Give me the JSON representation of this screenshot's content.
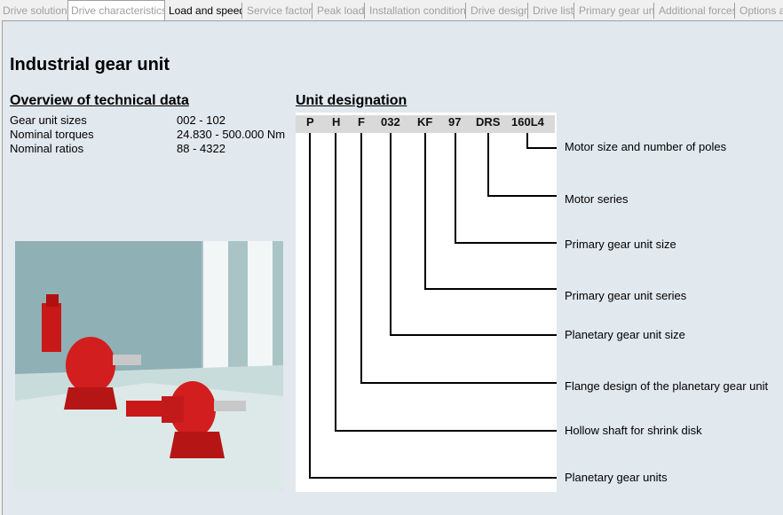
{
  "tabs": [
    {
      "label": "Drive solution",
      "state": "disabled"
    },
    {
      "label": "Drive characteristics",
      "state": "active"
    },
    {
      "label": "Load and speed",
      "state": "enabled"
    },
    {
      "label": "Service factor",
      "state": "disabled"
    },
    {
      "label": "Peak load",
      "state": "disabled"
    },
    {
      "label": "Installation conditions",
      "state": "disabled"
    },
    {
      "label": "Drive design",
      "state": "disabled"
    },
    {
      "label": "Drive list",
      "state": "disabled"
    },
    {
      "label": "Primary gear unit",
      "state": "disabled"
    },
    {
      "label": "Additional forces",
      "state": "disabled"
    },
    {
      "label": "Options a",
      "state": "disabled"
    }
  ],
  "page_title": "Industrial gear unit",
  "overview": {
    "heading": "Overview of technical data",
    "rows": [
      {
        "key": "Gear unit sizes",
        "value": "002 - 102"
      },
      {
        "key": "Nominal torques",
        "value": "24.830 - 500.000 Nm"
      },
      {
        "key": "Nominal ratios",
        "value": "88 - 4322"
      }
    ]
  },
  "designation": {
    "heading": "Unit designation",
    "codes": [
      "P",
      "H",
      "F",
      "032",
      "KF",
      "97",
      "DRS",
      "160L4"
    ],
    "labels": [
      "Planetary gear units",
      "Hollow shaft for shrink disk",
      "Flange design of the planetary gear unit",
      "Planetary gear unit size",
      "Primary gear unit series",
      "Primary gear unit size",
      "Motor series",
      "Motor size and number of poles"
    ]
  },
  "colors": {
    "content_bg": "#e1e8ee",
    "header_bar": "#d9d9d9",
    "gear_red": "#d21e1e"
  }
}
